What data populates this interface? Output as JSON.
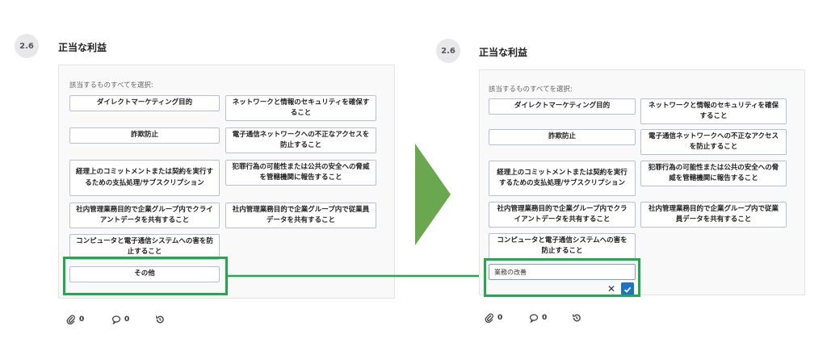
{
  "section": {
    "number": "2.6",
    "title": "正当な利益",
    "instruction": "該当するものすべてを選択:"
  },
  "options": [
    "ダイレクトマーケティング目的",
    "ネットワークと情報のセキュリティを確保すること",
    "詐欺防止",
    "電子通信ネットワークへの不正なアクセスを防止すること",
    "経理上のコミットメントまたは契約を実行するための支払処理/サブスクリプション",
    "犯罪行為の可能性または公共の安全への脅威を管轄機関に報告すること",
    "社内管理業務目的で企業グループ内でクライアントデータを共有すること",
    "社内管理業務目的で企業グループ内で従業員データを共有すること",
    "コンピュータと電子通信システムへの害を防止すること"
  ],
  "other_label": "その他",
  "other_input_value": "業務の改善",
  "footer": {
    "attachments": "0",
    "comments": "0"
  },
  "colors": {
    "highlight": "#1faa4b",
    "arrow": "#6aa84f",
    "confirm": "#1a72c9"
  }
}
